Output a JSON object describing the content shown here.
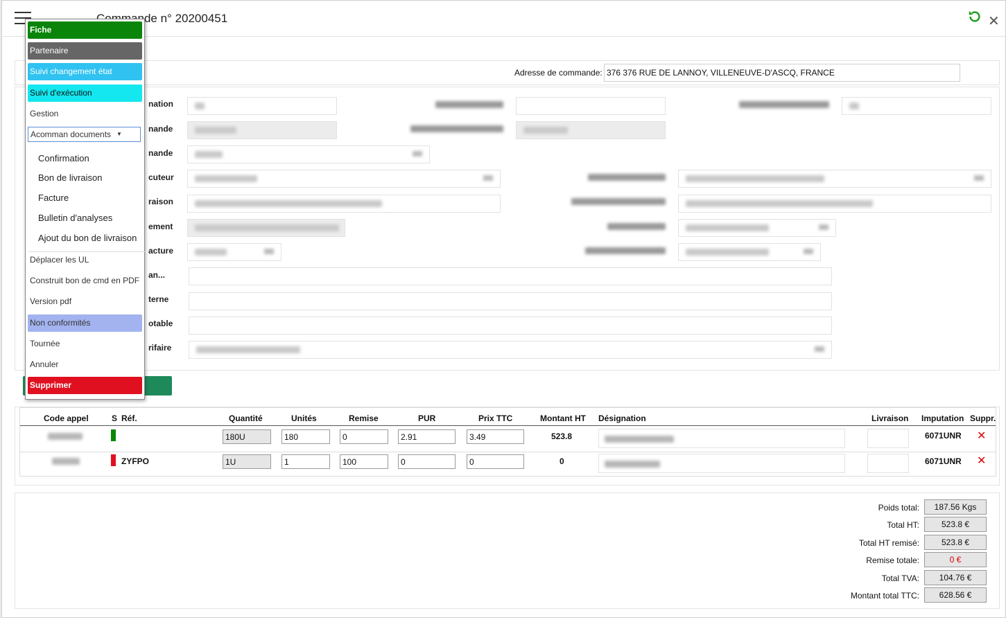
{
  "header": {
    "title": "Commande n° 20200451"
  },
  "address": {
    "label": "Adresse de commande:",
    "value": "376 376 RUE DE LANNOY, VILLENEUVE-D'ASCQ, FRANCE"
  },
  "form_labels": {
    "l1": "nation",
    "l2": "nande",
    "l3": "nande",
    "l4": "cuteur",
    "l5": "raison",
    "l6": "ement",
    "l7": "acture",
    "l8": "an...",
    "l9": "terne",
    "l10": "otable",
    "l11": "rifaire"
  },
  "menu": {
    "items": {
      "fiche": "Fiche",
      "partenaire": "Partenaire",
      "suivi_etat": "Suivi changement état",
      "suivi_exec": "Suivi d'exécution",
      "gestion": "Gestion",
      "documents_select": "Acomman documents",
      "deplacer": "Déplacer les UL",
      "construit": "Construit bon de cmd en PDF",
      "version_pdf": "Version pdf",
      "non_conformites": "Non conformités",
      "tournee": "Tournée",
      "annuler": "Annuler",
      "supprimer": "Supprimer"
    },
    "documents": [
      "Confirmation",
      "Bon de livraison",
      "Facture",
      "Bulletin d'analyses",
      "Ajout du bon de livraison"
    ]
  },
  "lines": {
    "headers": {
      "code_appel": "Code appel",
      "s": "S",
      "ref": "Réf.",
      "quantite": "Quantité",
      "unites": "Unités",
      "remise": "Remise",
      "pur": "PUR",
      "prix_ttc": "Prix TTC",
      "montant_ht": "Montant HT",
      "designation": "Désignation",
      "livraison": "Livraison",
      "imputation": "Imputation",
      "suppr": "Suppr."
    },
    "rows": [
      {
        "ref": "",
        "status_color": "#0a850a",
        "quantite": "180U",
        "unites": "180",
        "remise": "0",
        "pur": "2.91",
        "prix_ttc": "3.49",
        "montant_ht": "523.8",
        "imputation": "6071UNR"
      },
      {
        "ref": "ZYFPO",
        "status_color": "#e01020",
        "quantite": "1U",
        "unites": "1",
        "remise": "100",
        "pur": "0",
        "prix_ttc": "0",
        "montant_ht": "0",
        "imputation": "6071UNR"
      }
    ]
  },
  "totals": {
    "poids_label": "Poids total:",
    "poids_value": "187.56 Kgs",
    "total_ht_label": "Total HT:",
    "total_ht_value": "523.8 €",
    "total_ht_remise_label": "Total HT remisé:",
    "total_ht_remise_value": "523.8 €",
    "remise_totale_label": "Remise totale:",
    "remise_totale_value": "0 €",
    "total_tva_label": "Total TVA:",
    "total_tva_value": "104.76 €",
    "montant_ttc_label": "Montant total TTC:",
    "montant_ttc_value": "628.56 €"
  },
  "colors": {
    "accent_green": "#1e8a5a",
    "delete_red": "#e00000"
  }
}
